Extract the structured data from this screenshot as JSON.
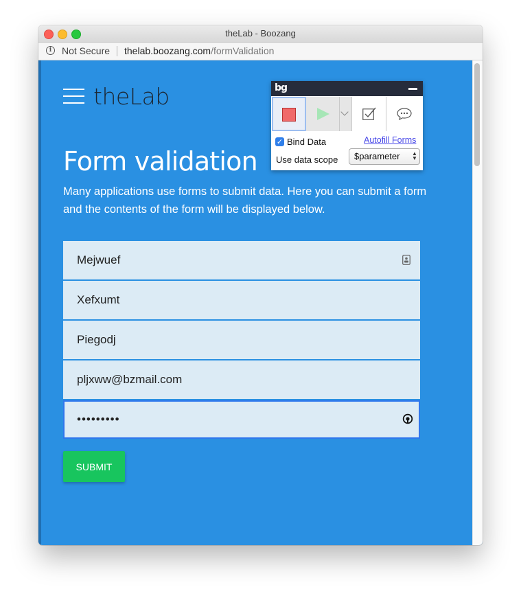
{
  "window": {
    "title": "theLab - Boozang"
  },
  "addressbar": {
    "security_label": "Not Secure",
    "url_host": "thelab.boozang.com",
    "url_path": "/formValidation"
  },
  "page": {
    "brand": "theLab",
    "title": "Form validation",
    "intro": "Many applications use forms to submit data. Here you can submit a form and the contents of the form will be displayed below."
  },
  "form": {
    "fields": [
      {
        "value": "Mejwuef",
        "type": "text"
      },
      {
        "value": "Xefxumt",
        "type": "text"
      },
      {
        "value": "Piegodj",
        "type": "text"
      },
      {
        "value": "pljxww@bzmail.com",
        "type": "email"
      },
      {
        "value": "secret123",
        "type": "password"
      }
    ],
    "submit_label": "SUBMIT"
  },
  "boozang_panel": {
    "logo": "bg",
    "bind_data_label": "Bind Data",
    "bind_data_checked": true,
    "autofill_label": "Autofill Forms",
    "scope_label": "Use data scope",
    "scope_value": "$parameter"
  },
  "colors": {
    "page_background": "#2a90e2",
    "field_background": "#dcebf5",
    "submit_background": "#18c55e",
    "panel_header": "#262c3b",
    "focus_ring": "#2f77ec"
  },
  "icons": [
    "info-icon",
    "hamburger-menu-icon",
    "contact-card-icon",
    "password-manager-icon",
    "record-icon",
    "play-icon",
    "chevron-down-icon",
    "checkbox-check-icon",
    "comment-bubble-icon",
    "select-arrows-icon"
  ]
}
